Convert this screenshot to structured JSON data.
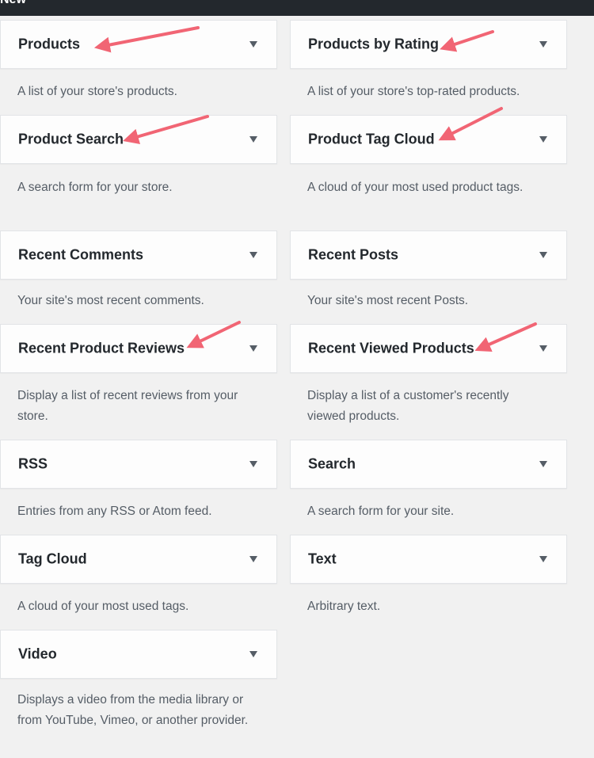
{
  "header": {
    "title": "New"
  },
  "icons": {
    "toggle": "dropdown-triangle-icon",
    "annotation": "pointer-arrow-icon"
  },
  "colors": {
    "annotation_arrow": "#f16574",
    "toolbar": "#23282d",
    "background": "#f1f1f1"
  },
  "widgets": [
    {
      "title": "Products",
      "description": "A list of your store's products."
    },
    {
      "title": "Products by Rating",
      "description": "A list of your store's top-rated products."
    },
    {
      "title": "Product Search",
      "description": "A search form for your store."
    },
    {
      "title": "Product Tag Cloud",
      "description": "A cloud of your most used product tags."
    },
    {
      "title": "Recent Comments",
      "description": "Your site's most recent comments."
    },
    {
      "title": "Recent Posts",
      "description": "Your site's most recent Posts."
    },
    {
      "title": "Recent Product Reviews",
      "description": "Display a list of recent reviews from your store."
    },
    {
      "title": "Recent Viewed Products",
      "description": "Display a list of a customer's recently viewed products."
    },
    {
      "title": "RSS",
      "description": "Entries from any RSS or Atom feed."
    },
    {
      "title": "Search",
      "description": "A search form for your site."
    },
    {
      "title": "Tag Cloud",
      "description": "A cloud of your most used tags."
    },
    {
      "title": "Text",
      "description": "Arbitrary text."
    },
    {
      "title": "Video",
      "description": "Displays a video from the media library or from YouTube, Vimeo, or another provider."
    }
  ]
}
